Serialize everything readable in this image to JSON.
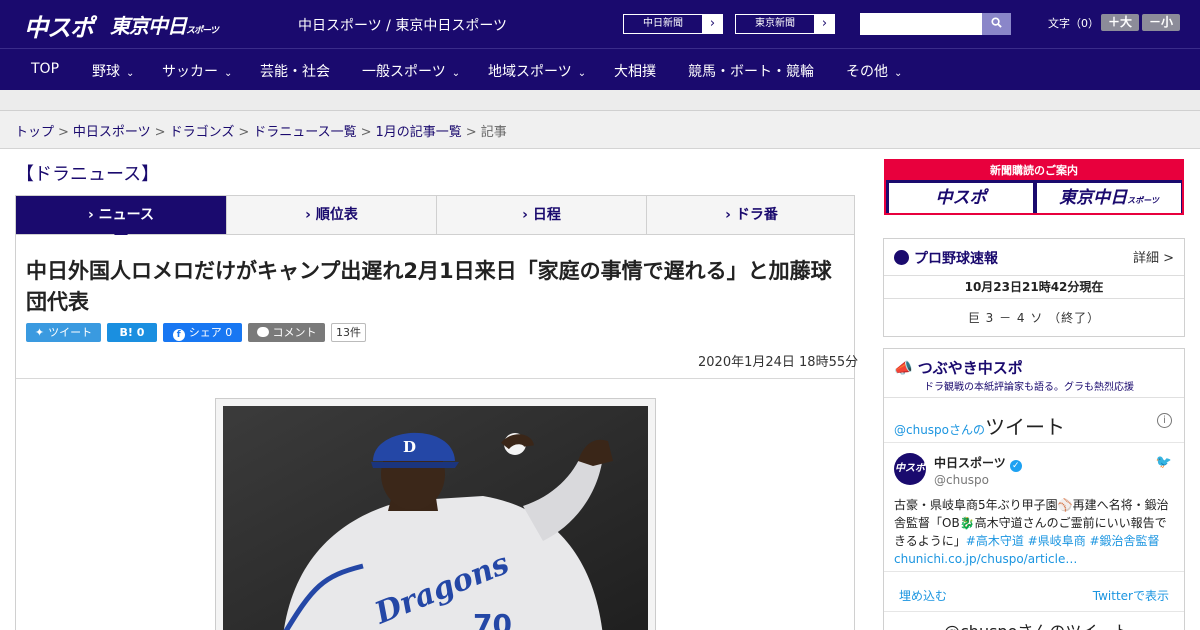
{
  "header": {
    "logo_chuspo": "中スポ",
    "logo_tokyo": "東京中日",
    "logo_tokyo_small": "スポーツ",
    "site_title": "中日スポーツ / 東京中日スポーツ",
    "ext_links": [
      {
        "label": "中日新聞",
        "arrow": "›"
      },
      {
        "label": "東京新聞",
        "arrow": "›"
      }
    ],
    "search_placeholder": "",
    "search_icon": "search-icon",
    "font_size_label": "文字（0）",
    "font_larger": "＋大",
    "font_smaller": "－小"
  },
  "nav": {
    "items": [
      {
        "label": "TOP",
        "chevron": ""
      },
      {
        "label": "野球",
        "chevron": "⌄"
      },
      {
        "label": "サッカー",
        "chevron": "⌄"
      },
      {
        "label": "芸能・社会",
        "chevron": ""
      },
      {
        "label": "一般スポーツ",
        "chevron": "⌄"
      },
      {
        "label": "地域スポーツ",
        "chevron": "⌄"
      },
      {
        "label": "大相撲",
        "chevron": ""
      },
      {
        "label": "競馬・ボート・競輪",
        "chevron": ""
      },
      {
        "label": "その他",
        "chevron": "⌄"
      }
    ]
  },
  "breadcrumb": {
    "items": [
      "トップ",
      "中日スポーツ",
      "ドラゴンズ",
      "ドラニュース一覧",
      "1月の記事一覧"
    ],
    "current": "記事",
    "separator": ">"
  },
  "main": {
    "section_title": "【ドラニュース】",
    "tabs": [
      {
        "label": "› ニュース",
        "active": true
      },
      {
        "label": "› 順位表",
        "active": false
      },
      {
        "label": "› 日程",
        "active": false
      },
      {
        "label": "› ドラ番",
        "active": false
      }
    ],
    "headline": "中日外国人ロメロだけがキャンプ出遅れ2月1日来日「家庭の事情で遅れる」と加藤球団代表",
    "share": {
      "tweet": "ツイート",
      "hatena": "B! 0",
      "facebook": "シェア 0",
      "comment": "コメント",
      "comment_count": "13件"
    },
    "date": "2020年1月24日 18時55分"
  },
  "sidebar": {
    "promo": {
      "title": "新聞購読のご案内",
      "chuspo": "中スポ",
      "tokyo": "東京中日",
      "tokyo_small": "スポーツ"
    },
    "baseball": {
      "title": "プロ野球速報",
      "detail": "詳細 >",
      "time": "10月23日21時42分現在",
      "score": "巨 3 － 4 ソ （終了）"
    },
    "tweets": {
      "title": "つぶやき中スポ",
      "subtitle": "ドラ観戦の本紙評論家も語る。グラも熱烈応援",
      "timeline_user": "@chuspoさんの",
      "timeline_label": "ツイート",
      "info": "i",
      "avatar": "中スポ",
      "name": "中日スポーツ",
      "handle": "@chuspo",
      "text_1": "古豪・県岐阜商5年ぶり甲子園",
      "text_2": "再建へ名将・鍛治舎監督「OB",
      "text_3": "高木守道さんのご霊前にいい報告できるように」",
      "tags": "#高木守道 #県岐阜商 #鍛治舎監督",
      "link": "chunichi.co.jp/chuspo/article…",
      "embed": "埋め込む",
      "view_on_twitter": "Twitterで表示",
      "footer": "@chuspoさんのツイート"
    }
  }
}
